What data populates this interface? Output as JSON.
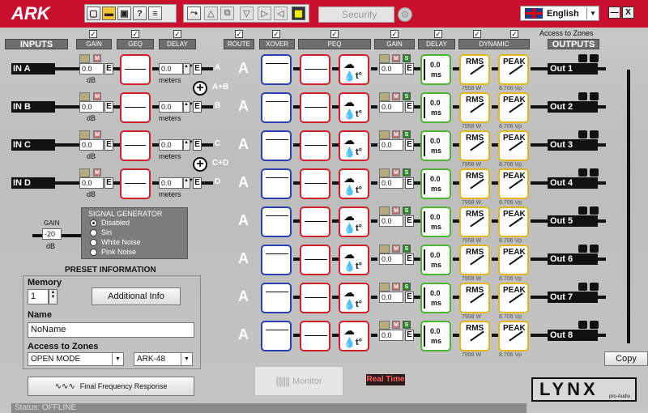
{
  "app": {
    "logo": "ARK"
  },
  "toolbar": {
    "file_icons": [
      "new-file-icon",
      "open-folder-icon",
      "save-icon",
      "help-icon",
      "document-icon"
    ],
    "edit_icons": [
      "route-icon",
      "up-arrow-icon",
      "copy-icon",
      "down-arrow-icon",
      "play-icon",
      "split-icon",
      "calc-icon"
    ],
    "security_label": "Security",
    "language": "English",
    "minimize": "—",
    "close": "X"
  },
  "headers": {
    "inputs": "INPUTS",
    "gain": "GAIN",
    "geq": "GEQ",
    "delay": "DELAY",
    "route": "ROUTE",
    "xover": "XOVER",
    "peq": "PEQ",
    "out_gain": "GAIN",
    "out_delay": "DELAY",
    "dynamic": "DYNAMIC",
    "outputs": "OUTPUTS",
    "access_to_zones": "Access to Zones"
  },
  "inputs": [
    {
      "name": "IN A",
      "gain": "0.0",
      "gain_unit": "dB",
      "delay": "0.0",
      "delay_unit": "meters",
      "mute": "M",
      "eq": "E",
      "route": "A"
    },
    {
      "name": "IN B",
      "gain": "0.0",
      "gain_unit": "dB",
      "delay": "0.0",
      "delay_unit": "meters",
      "mute": "M",
      "eq": "E",
      "route": "B"
    },
    {
      "name": "IN C",
      "gain": "0.0",
      "gain_unit": "dB",
      "delay": "0.0",
      "delay_unit": "meters",
      "mute": "M",
      "eq": "E",
      "route": "C"
    },
    {
      "name": "IN D",
      "gain": "0.0",
      "gain_unit": "dB",
      "delay": "0.0",
      "delay_unit": "meters",
      "mute": "M",
      "eq": "E",
      "route": "D"
    }
  ],
  "sums": [
    "A+B",
    "C+D"
  ],
  "outputs": [
    {
      "name": "Out 1",
      "route": "A",
      "gain": "0.0",
      "delay": "0.0",
      "delay_unit": "ms",
      "rms": "RMS",
      "peak": "PEAK",
      "rms_value": "7958 W",
      "peak_value": "8.706 Vp",
      "mute": "M",
      "solo": "S",
      "eq": "E"
    },
    {
      "name": "Out 2",
      "route": "A",
      "gain": "0.0",
      "delay": "0.0",
      "delay_unit": "ms",
      "rms": "RMS",
      "peak": "PEAK",
      "rms_value": "7958 W",
      "peak_value": "8.706 Vp",
      "mute": "M",
      "solo": "S",
      "eq": "E"
    },
    {
      "name": "Out 3",
      "route": "A",
      "gain": "0.0",
      "delay": "0.0",
      "delay_unit": "ms",
      "rms": "RMS",
      "peak": "PEAK",
      "rms_value": "7958 W",
      "peak_value": "8.706 Vp",
      "mute": "M",
      "solo": "S",
      "eq": "E"
    },
    {
      "name": "Out 4",
      "route": "A",
      "gain": "0.0",
      "delay": "0.0",
      "delay_unit": "ms",
      "rms": "RMS",
      "peak": "PEAK",
      "rms_value": "7958 W",
      "peak_value": "8.706 Vp",
      "mute": "M",
      "solo": "S",
      "eq": "E"
    },
    {
      "name": "Out 5",
      "route": "A",
      "gain": "0.0",
      "delay": "0.0",
      "delay_unit": "ms",
      "rms": "RMS",
      "peak": "PEAK",
      "rms_value": "7958 W",
      "peak_value": "8.706 Vp",
      "mute": "M",
      "solo": "S",
      "eq": "E"
    },
    {
      "name": "Out 6",
      "route": "A",
      "gain": "0.0",
      "delay": "0.0",
      "delay_unit": "ms",
      "rms": "RMS",
      "peak": "PEAK",
      "rms_value": "7958 W",
      "peak_value": "8.706 Vp",
      "mute": "M",
      "solo": "S",
      "eq": "E"
    },
    {
      "name": "Out 7",
      "route": "A",
      "gain": "0.0",
      "delay": "0.0",
      "delay_unit": "ms",
      "rms": "RMS",
      "peak": "PEAK",
      "rms_value": "7958 W",
      "peak_value": "8.706 Vp",
      "mute": "M",
      "solo": "S",
      "eq": "E"
    },
    {
      "name": "Out 8",
      "route": "A",
      "gain": "0.0",
      "delay": "0.0",
      "delay_unit": "ms",
      "rms": "RMS",
      "peak": "PEAK",
      "rms_value": "7958 W",
      "peak_value": "8.706 Vp",
      "mute": "M",
      "solo": "S",
      "eq": "E"
    }
  ],
  "generator": {
    "gain_label": "GAIN",
    "gain_value": "-20",
    "gain_unit": "dB",
    "title": "SIGNAL GENERATOR",
    "options": [
      "Disabled",
      "Sin",
      "White Noise",
      "Pink Noise"
    ],
    "selected": "Disabled"
  },
  "preset": {
    "title": "PRESET INFORMATION",
    "memory_label": "Memory",
    "memory_value": "1",
    "additional_info": "Additional Info",
    "name_label": "Name",
    "name_value": "NoName",
    "zones_label": "Access to Zones",
    "zone_mode": "OPEN MODE",
    "model": "ARK-48"
  },
  "bottom": {
    "final_response": "Final Frequency Response",
    "monitor": "Monitor",
    "realtime": "Real Time",
    "copy": "Copy",
    "status": "Status:  OFFLINE",
    "brand": "LYNX",
    "brand_sub": "pro-Audio"
  },
  "colors": {
    "topbar": "#c8102e",
    "xover": "#2a3fb0",
    "peq": "#d0202c",
    "delay": "#4cb531",
    "dynamic": "#e3b71a"
  }
}
